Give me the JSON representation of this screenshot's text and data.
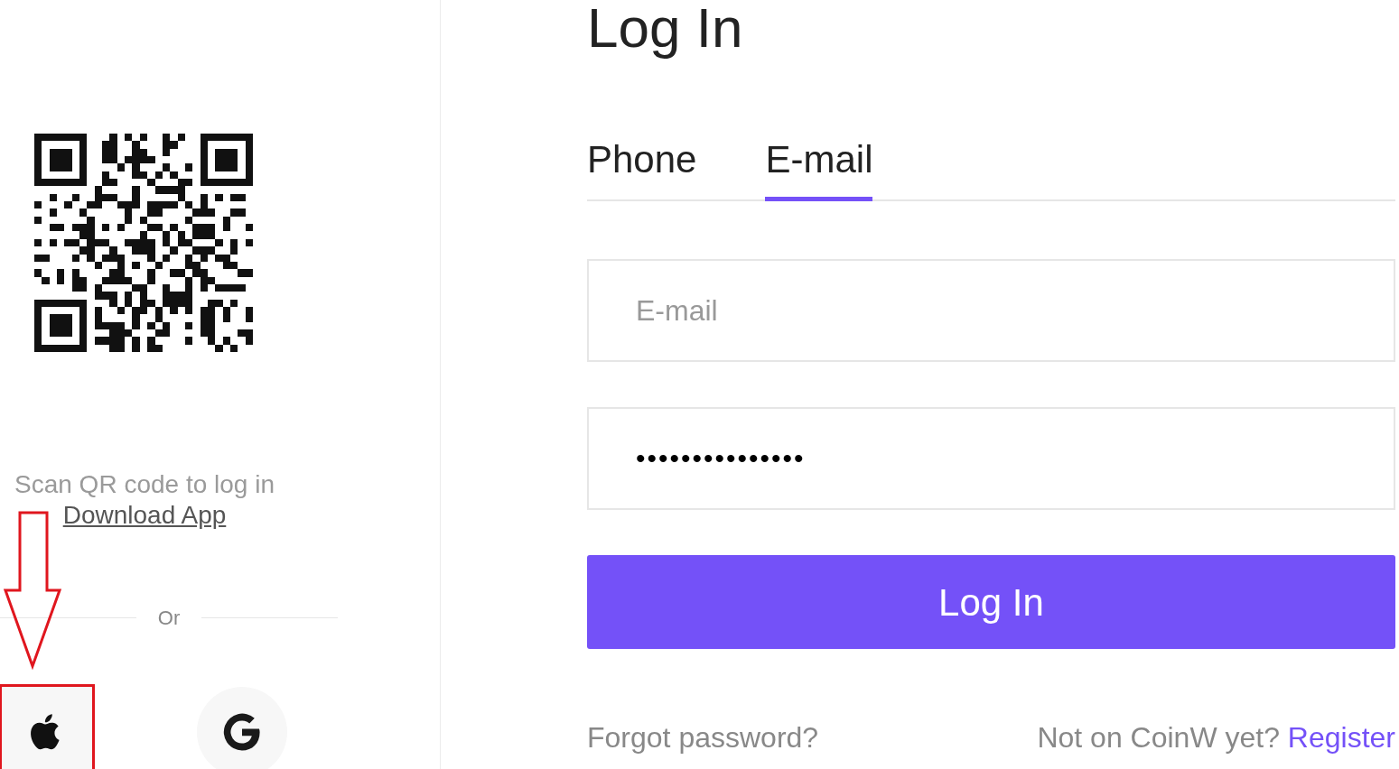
{
  "qr_panel": {
    "caption": "Scan QR code to log in",
    "download_link": "Download App",
    "divider_label": "Or"
  },
  "social_logins": [
    {
      "kind": "apple",
      "highlighted": true
    },
    {
      "kind": "google",
      "highlighted": false
    }
  ],
  "title": "Log In",
  "tabs": [
    {
      "label": "Phone",
      "selected": false
    },
    {
      "label": "E-mail",
      "selected": true
    }
  ],
  "email_field": {
    "placeholder": "E-mail"
  },
  "password_field": {
    "value": "•••••••••••••••"
  },
  "login_button": "Log In",
  "forgot_link": "Forgot password?",
  "register_prompt": {
    "text": "Not on CoinW yet?",
    "link": "Register"
  }
}
